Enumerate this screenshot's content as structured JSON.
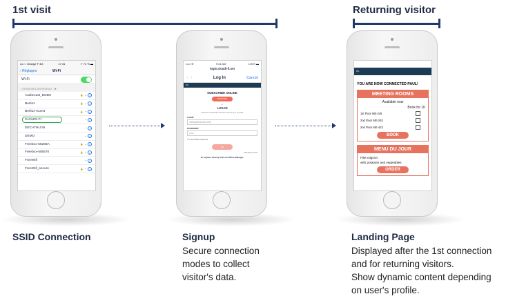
{
  "headers": {
    "first_visit": "1st visit",
    "returning_visitor": "Returning visitor"
  },
  "phone1": {
    "status_left": "•••○○ Orange F  4G",
    "status_time": "17:31",
    "status_right": "↗ 72 % ▬",
    "back_label": "Réglages",
    "title": "Wi-Fi",
    "wifi_label": "Wi-Fi",
    "section_label": "CHOISISSEZ UN RÉSEAU...",
    "networks": [
      "AudioCast_DDD8",
      "Berlioz",
      "Berlioz-Guest",
      "CLOUDI-FI",
      "DECATHLON",
      "DEMO",
      "Freebox-55268A",
      "Freebox-605570",
      "FreeWifi",
      "FreeWifi_secure"
    ]
  },
  "phone2": {
    "status_left": "•••••  ✆",
    "status_time": "9:41 AM",
    "status_right": "100% ▬",
    "url": "login.cloudi-fi.net",
    "title": "Log In",
    "cancel": "Cancel",
    "bar": "Wi-",
    "subscribe_title": "SUBSCRIBE ONLINE",
    "register_btn": "REGISTER",
    "or": "or",
    "login_title": "LOG IN",
    "hint": "Enter the credentials that were sent to you by SMS",
    "login_label": "LOGIN*",
    "login_value": "melissa@cloudi-fi.com",
    "password_label": "PASSWORD*",
    "password_value": "••••••",
    "remember": "☐ I remember password",
    "ok_btn": "OK",
    "mandatory": "*Mandatory fields",
    "register_direct": "Or register directly with our Office Manager."
  },
  "phone3": {
    "bar": "Wi-",
    "connected": "YOU ARE NOW CONNECTED PAUL!",
    "meeting_title": "MEETING ROOMS",
    "available": "Available now",
    "book_for": "Book for 1h",
    "rooms": [
      "1st Floor ME-245",
      "2nd Floor ME-263",
      "2nd Floor ME-423"
    ],
    "book_btn": "BOOK",
    "menu_title": "MENU DU JOUR",
    "menu_line1": "Filet mignon",
    "menu_line2": "with potatoes and vegetables",
    "order_btn": "ORDER"
  },
  "captions": {
    "ssid": "SSID Connection",
    "signup_title": "Signup",
    "signup_lines": [
      "Secure connection",
      "modes to collect",
      "visitor's data."
    ],
    "landing_title": "Landing Page",
    "landing_lines": [
      "Displayed after the 1st connection",
      "and for returning visitors.",
      "Show dynamic content depending",
      "on user's profile."
    ]
  }
}
